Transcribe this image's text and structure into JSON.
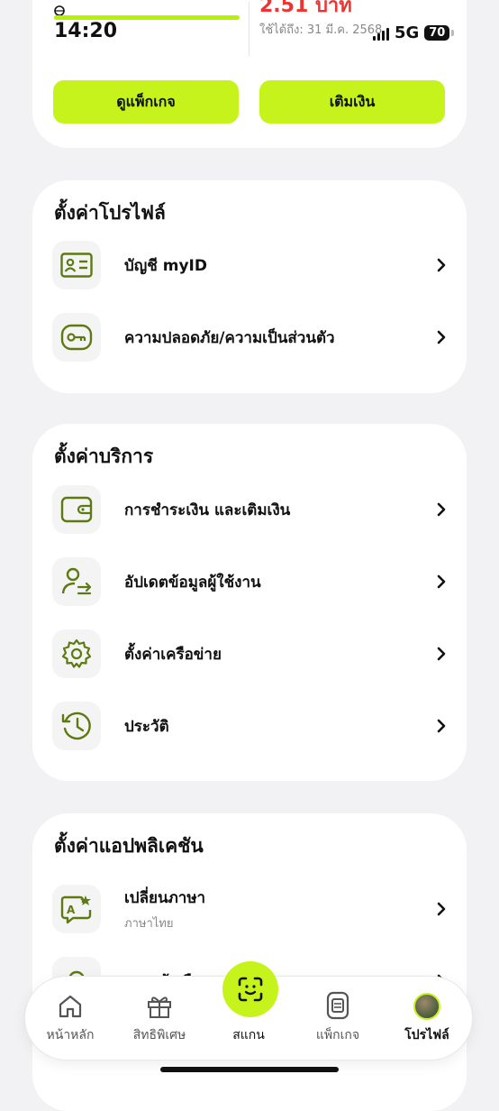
{
  "status_bar": {
    "time": "14:20",
    "network": "5G",
    "battery": "70"
  },
  "top_card": {
    "amount": "2.51 บาท",
    "expiry": "ใช้ได้ถึง: 31 มี.ค. 2568",
    "package_button": "ดูแพ็กเกจ",
    "topup_button": "เติมเงิน"
  },
  "profile_settings": {
    "title": "ตั้งค่าโปรไฟล์",
    "items": [
      {
        "label": "บัญชี myID",
        "icon": "id-card-icon"
      },
      {
        "label": "ความปลอดภัย/ความเป็นส่วนตัว",
        "icon": "key-icon"
      }
    ]
  },
  "service_settings": {
    "title": "ตั้งค่าบริการ",
    "items": [
      {
        "label": "การชำระเงิน และเติมเงิน",
        "icon": "wallet-icon"
      },
      {
        "label": "อัปเดตข้อมูลผู้ใช้งาน",
        "icon": "user-swap-icon"
      },
      {
        "label": "ตั้งค่าเครือข่าย",
        "icon": "gear-icon"
      },
      {
        "label": "ประวัติ",
        "icon": "history-icon"
      }
    ]
  },
  "app_settings": {
    "title": "ตั้งค่าแอปพลิเคชัน",
    "items": [
      {
        "label": "เปลี่ยนภาษา",
        "sub": "ภาษาไทย",
        "icon": "translate-icon"
      },
      {
        "label": "การแจ้งเตือน",
        "icon": "bell-icon"
      }
    ]
  },
  "tabbar": {
    "tabs": [
      {
        "label": "หน้าหลัก",
        "icon": "home-icon"
      },
      {
        "label": "สิทธิพิเศษ",
        "icon": "gift-icon"
      },
      {
        "label": "สแกน",
        "icon": "scan-icon"
      },
      {
        "label": "แพ็กเกจ",
        "icon": "sim-package-icon"
      },
      {
        "label": "โปรไฟล์",
        "icon": "avatar"
      }
    ],
    "active": "โปรไฟล์"
  },
  "colors": {
    "accent": "#c5f31b",
    "icon_green": "#5d7a12",
    "alert_red": "#e33333",
    "background": "#f2f2f4"
  }
}
